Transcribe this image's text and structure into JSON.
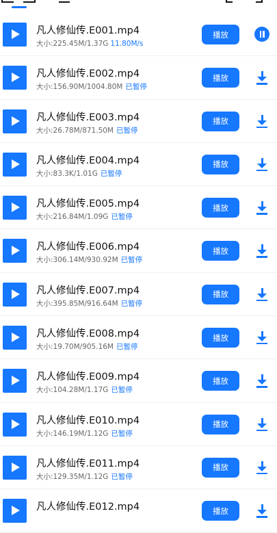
{
  "colors": {
    "accent": "#1677ff",
    "text": "#111111",
    "muted": "#666666"
  },
  "items": [
    {
      "title": "凡人修仙传.E001.mp4",
      "size": "大小:225.45M/1.37G",
      "status": "",
      "speed": "11.80M/s",
      "play_label": "播放",
      "action_icon": "pause-icon"
    },
    {
      "title": "凡人修仙传.E002.mp4",
      "size": "大小:156.90M/1004.80M",
      "status": "已暂停",
      "speed": "",
      "play_label": "播放",
      "action_icon": "download-icon"
    },
    {
      "title": "凡人修仙传.E003.mp4",
      "size": "大小:26.78M/871.50M",
      "status": "已暂停",
      "speed": "",
      "play_label": "播放",
      "action_icon": "download-icon"
    },
    {
      "title": "凡人修仙传.E004.mp4",
      "size": "大小:83.3K/1.01G",
      "status": "已暂停",
      "speed": "",
      "play_label": "播放",
      "action_icon": "download-icon"
    },
    {
      "title": "凡人修仙传.E005.mp4",
      "size": "大小:216.84M/1.09G",
      "status": "已暂停",
      "speed": "",
      "play_label": "播放",
      "action_icon": "download-icon"
    },
    {
      "title": "凡人修仙传.E006.mp4",
      "size": "大小:306.14M/930.92M",
      "status": "已暂停",
      "speed": "",
      "play_label": "播放",
      "action_icon": "download-icon"
    },
    {
      "title": "凡人修仙传.E007.mp4",
      "size": "大小:395.85M/916.64M",
      "status": "已暂停",
      "speed": "",
      "play_label": "播放",
      "action_icon": "download-icon"
    },
    {
      "title": "凡人修仙传.E008.mp4",
      "size": "大小:19.70M/905.16M",
      "status": "已暂停",
      "speed": "",
      "play_label": "播放",
      "action_icon": "download-icon"
    },
    {
      "title": "凡人修仙传.E009.mp4",
      "size": "大小:104.28M/1.17G",
      "status": "已暂停",
      "speed": "",
      "play_label": "播放",
      "action_icon": "download-icon"
    },
    {
      "title": "凡人修仙传.E010.mp4",
      "size": "大小:146.19M/1.12G",
      "status": "已暂停",
      "speed": "",
      "play_label": "播放",
      "action_icon": "download-icon"
    },
    {
      "title": "凡人修仙传.E011.mp4",
      "size": "大小:129.35M/1.12G",
      "status": "已暂停",
      "speed": "",
      "play_label": "播放",
      "action_icon": "download-icon"
    },
    {
      "title": "凡人修仙传.E012.mp4",
      "size": "",
      "status": "",
      "speed": "",
      "play_label": "播放",
      "action_icon": "download-icon"
    }
  ]
}
